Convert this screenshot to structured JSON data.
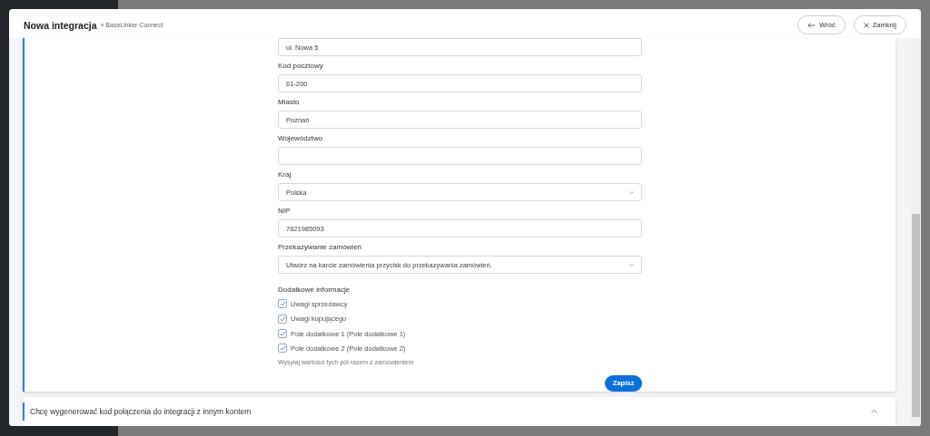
{
  "header": {
    "title": "Nowa integracja",
    "breadcrumb": "» BaseLinker Connect",
    "buttons": [
      {
        "kind": "back",
        "label": "Wróć"
      },
      {
        "kind": "close",
        "label": "Zamknij"
      }
    ]
  },
  "form": {
    "fields": [
      {
        "kind": "text",
        "value": "ul. Nowa 5"
      },
      {
        "kind": "text",
        "label": "Kod pocztowy",
        "value": "61-200"
      },
      {
        "kind": "text",
        "label": "Miasto",
        "value": "Poznań"
      },
      {
        "kind": "text",
        "label": "Województwo"
      },
      {
        "kind": "select",
        "label": "Kraj",
        "value": "Polska"
      },
      {
        "kind": "text",
        "label": "NIP",
        "value": "7821985093"
      },
      {
        "kind": "select",
        "label": "Przekazywanie zamówień",
        "value": "Utwórz na karcie zamówienia przycisk do przekazywania zamówień."
      }
    ],
    "additional": {
      "title": "Dodatkowe informacje",
      "options": [
        {
          "label": "Uwagi sprzedawcy",
          "checked": true
        },
        {
          "label": "Uwagi kupującego",
          "checked": true
        },
        {
          "label": "Pole dodatkowe 1 (Pole dodatkowe 1)",
          "checked": true
        },
        {
          "label": "Pole dodatkowe 2 (Pole dodatkowe 2)",
          "checked": true
        }
      ],
      "hint": "Wysyłaj wartości tych pól razem z zamówieniem"
    },
    "save_button": "Zapisz"
  },
  "accordion": {
    "title": "Chcę wygenerować kod połączenia do integracji z innym kontem"
  }
}
